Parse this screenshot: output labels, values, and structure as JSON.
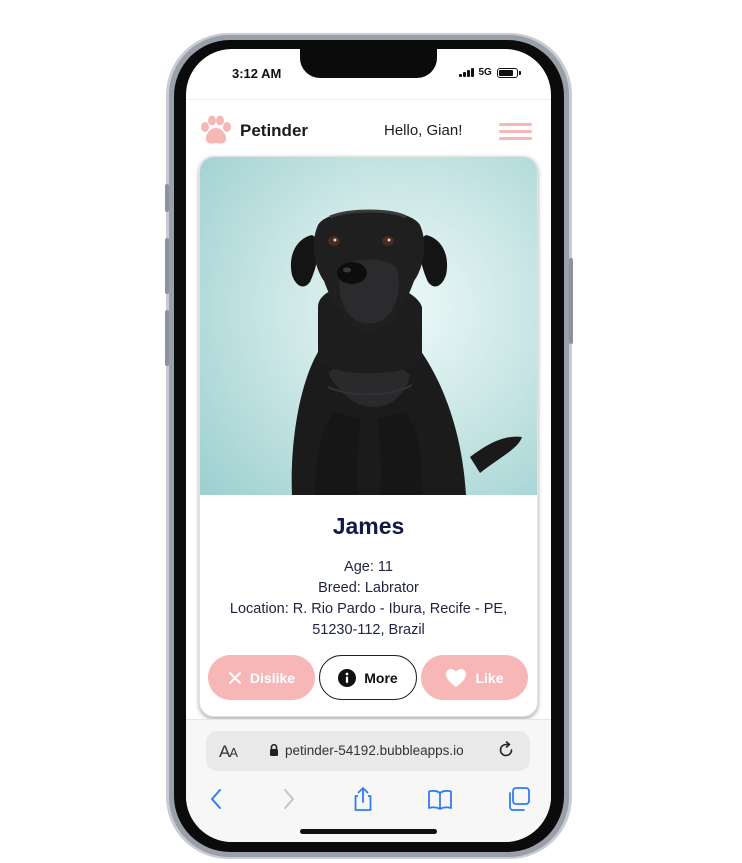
{
  "status_bar": {
    "time": "3:12 AM",
    "network": "5G"
  },
  "header": {
    "brand": "Petinder",
    "greeting": "Hello, Gian!"
  },
  "pet": {
    "name": "James",
    "age": "Age: 11",
    "breed": "Breed: Labrator",
    "location_line1": "Location: R. Rio Pardo - Ibura, Recife - PE,",
    "location_line2": "51230-112, Brazil"
  },
  "actions": {
    "dislike": "Dislike",
    "more": "More",
    "like": "Like"
  },
  "browser": {
    "aa_big": "A",
    "aa_small": "A",
    "url": "petinder-54192.bubbleapps.io"
  },
  "colors": {
    "accent_pink": "#f7b7b7",
    "name_navy": "#0f1b45",
    "ios_blue": "#2f7cf6"
  },
  "icons": [
    "paw-icon",
    "menu-icon",
    "close-icon",
    "info-icon",
    "heart-icon",
    "lock-icon",
    "reload-icon",
    "back-icon",
    "forward-icon",
    "share-icon",
    "bookmarks-icon",
    "tabs-icon"
  ]
}
